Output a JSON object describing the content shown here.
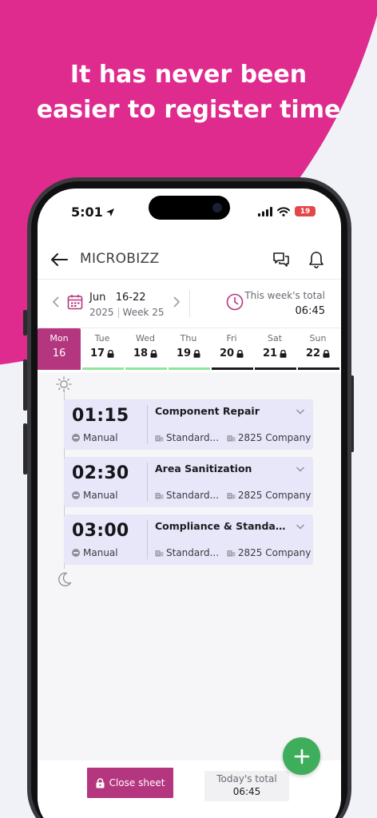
{
  "promo": {
    "headline_line1": "It has never been",
    "headline_line2": "easier to register time",
    "brand_color": "#df2a8e"
  },
  "status_bar": {
    "time": "5:01",
    "battery": "19"
  },
  "header": {
    "title": "MICROBIZZ"
  },
  "week_nav": {
    "month": "Jun",
    "range": "16-22",
    "year": "2025",
    "week": "Week 25",
    "total_label": "This week's total",
    "total_value": "06:45"
  },
  "days": [
    {
      "name": "Mon",
      "num": "16",
      "selected": true,
      "locked": false
    },
    {
      "name": "Tue",
      "num": "17",
      "selected": false,
      "locked": true
    },
    {
      "name": "Wed",
      "num": "18",
      "selected": false,
      "locked": true
    },
    {
      "name": "Thu",
      "num": "19",
      "selected": false,
      "locked": true
    },
    {
      "name": "Fri",
      "num": "20",
      "selected": false,
      "locked": true
    },
    {
      "name": "Sat",
      "num": "21",
      "selected": false,
      "locked": true
    },
    {
      "name": "Sun",
      "num": "22",
      "selected": false,
      "locked": true
    }
  ],
  "entries": [
    {
      "time": "01:15",
      "type": "Manual",
      "task": "Component Repair",
      "category": "Standard...",
      "company": "2825 Company"
    },
    {
      "time": "02:30",
      "type": "Manual",
      "task": "Area Sanitization",
      "category": "Standard...",
      "company": "2825 Company"
    },
    {
      "time": "03:00",
      "type": "Manual",
      "task": "Compliance & Standard...",
      "category": "Standard...",
      "company": "2825 Company"
    }
  ],
  "bottom": {
    "close_label": "Close sheet",
    "today_label": "Today's total",
    "today_value": "06:45"
  },
  "colors": {
    "accent": "#b4367f",
    "fab": "#3fae5c",
    "entry_bg": "#e7e7f9",
    "day_bar_green": "#8ee69b",
    "day_bar_dark": "#1b1b1f"
  }
}
